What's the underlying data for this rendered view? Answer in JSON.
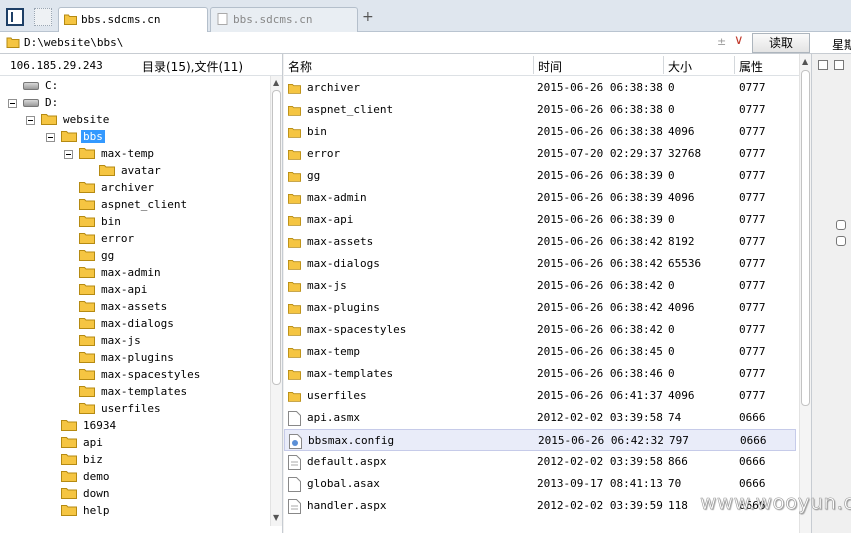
{
  "tabs": [
    {
      "label": "bbs.sdcms.cn",
      "active": true
    },
    {
      "label": "bbs.sdcms.cn",
      "active": false
    }
  ],
  "address": {
    "path": "D:\\website\\bbs\\",
    "read_button": "读取",
    "week_label": "星期"
  },
  "left": {
    "ip": "106.185.29.243",
    "counts": "目录(15),文件(11)"
  },
  "tree": [
    {
      "label": "C:",
      "type": "drive",
      "level": 1,
      "expanded": false,
      "selected": false
    },
    {
      "label": "D:",
      "type": "drive",
      "level": 1,
      "expanded": true,
      "selected": false
    },
    {
      "label": "website",
      "type": "folder",
      "level": 2,
      "expanded": true,
      "selected": false
    },
    {
      "label": "bbs",
      "type": "folder",
      "level": 3,
      "expanded": true,
      "selected": true
    },
    {
      "label": "max-temp",
      "type": "folder",
      "level": 4,
      "expanded": true,
      "selected": false
    },
    {
      "label": "avatar",
      "type": "folder",
      "level": 5,
      "expanded": false,
      "selected": false
    },
    {
      "label": "archiver",
      "type": "folder",
      "level": 4,
      "expanded": false,
      "selected": false
    },
    {
      "label": "aspnet_client",
      "type": "folder",
      "level": 4,
      "expanded": false,
      "selected": false
    },
    {
      "label": "bin",
      "type": "folder",
      "level": 4,
      "expanded": false,
      "selected": false
    },
    {
      "label": "error",
      "type": "folder",
      "level": 4,
      "expanded": false,
      "selected": false
    },
    {
      "label": "gg",
      "type": "folder",
      "level": 4,
      "expanded": false,
      "selected": false
    },
    {
      "label": "max-admin",
      "type": "folder",
      "level": 4,
      "expanded": false,
      "selected": false
    },
    {
      "label": "max-api",
      "type": "folder",
      "level": 4,
      "expanded": false,
      "selected": false
    },
    {
      "label": "max-assets",
      "type": "folder",
      "level": 4,
      "expanded": false,
      "selected": false
    },
    {
      "label": "max-dialogs",
      "type": "folder",
      "level": 4,
      "expanded": false,
      "selected": false
    },
    {
      "label": "max-js",
      "type": "folder",
      "level": 4,
      "expanded": false,
      "selected": false
    },
    {
      "label": "max-plugins",
      "type": "folder",
      "level": 4,
      "expanded": false,
      "selected": false
    },
    {
      "label": "max-spacestyles",
      "type": "folder",
      "level": 4,
      "expanded": false,
      "selected": false
    },
    {
      "label": "max-templates",
      "type": "folder",
      "level": 4,
      "expanded": false,
      "selected": false
    },
    {
      "label": "userfiles",
      "type": "folder",
      "level": 4,
      "expanded": false,
      "selected": false
    },
    {
      "label": "16934",
      "type": "folder",
      "level": 3,
      "expanded": false,
      "selected": false
    },
    {
      "label": "api",
      "type": "folder",
      "level": 3,
      "expanded": false,
      "selected": false
    },
    {
      "label": "biz",
      "type": "folder",
      "level": 3,
      "expanded": false,
      "selected": false
    },
    {
      "label": "demo",
      "type": "folder",
      "level": 3,
      "expanded": false,
      "selected": false
    },
    {
      "label": "down",
      "type": "folder",
      "level": 3,
      "expanded": false,
      "selected": false
    },
    {
      "label": "help",
      "type": "folder",
      "level": 3,
      "expanded": false,
      "selected": false
    }
  ],
  "columns": {
    "name": "名称",
    "time": "时间",
    "size": "大小",
    "attr": "属性"
  },
  "files": [
    {
      "name": "archiver",
      "time": "2015-06-26 06:38:38",
      "size": "0",
      "attr": "0777",
      "kind": "folder"
    },
    {
      "name": "aspnet_client",
      "time": "2015-06-26 06:38:38",
      "size": "0",
      "attr": "0777",
      "kind": "folder"
    },
    {
      "name": "bin",
      "time": "2015-06-26 06:38:38",
      "size": "4096",
      "attr": "0777",
      "kind": "folder"
    },
    {
      "name": "error",
      "time": "2015-07-20 02:29:37",
      "size": "32768",
      "attr": "0777",
      "kind": "folder"
    },
    {
      "name": "gg",
      "time": "2015-06-26 06:38:39",
      "size": "0",
      "attr": "0777",
      "kind": "folder"
    },
    {
      "name": "max-admin",
      "time": "2015-06-26 06:38:39",
      "size": "4096",
      "attr": "0777",
      "kind": "folder"
    },
    {
      "name": "max-api",
      "time": "2015-06-26 06:38:39",
      "size": "0",
      "attr": "0777",
      "kind": "folder"
    },
    {
      "name": "max-assets",
      "time": "2015-06-26 06:38:42",
      "size": "8192",
      "attr": "0777",
      "kind": "folder"
    },
    {
      "name": "max-dialogs",
      "time": "2015-06-26 06:38:42",
      "size": "65536",
      "attr": "0777",
      "kind": "folder"
    },
    {
      "name": "max-js",
      "time": "2015-06-26 06:38:42",
      "size": "0",
      "attr": "0777",
      "kind": "folder"
    },
    {
      "name": "max-plugins",
      "time": "2015-06-26 06:38:42",
      "size": "4096",
      "attr": "0777",
      "kind": "folder"
    },
    {
      "name": "max-spacestyles",
      "time": "2015-06-26 06:38:42",
      "size": "0",
      "attr": "0777",
      "kind": "folder"
    },
    {
      "name": "max-temp",
      "time": "2015-06-26 06:38:45",
      "size": "0",
      "attr": "0777",
      "kind": "folder"
    },
    {
      "name": "max-templates",
      "time": "2015-06-26 06:38:46",
      "size": "0",
      "attr": "0777",
      "kind": "folder"
    },
    {
      "name": "userfiles",
      "time": "2015-06-26 06:41:37",
      "size": "4096",
      "attr": "0777",
      "kind": "folder"
    },
    {
      "name": "api.asmx",
      "time": "2012-02-02 03:39:58",
      "size": "74",
      "attr": "0666",
      "kind": "file"
    },
    {
      "name": "bbsmax.config",
      "time": "2015-06-26 06:42:32",
      "size": "797",
      "attr": "0666",
      "kind": "config",
      "highlighted": true
    },
    {
      "name": "default.aspx",
      "time": "2012-02-02 03:39:58",
      "size": "866",
      "attr": "0666",
      "kind": "doc"
    },
    {
      "name": "global.asax",
      "time": "2013-09-17 08:41:13",
      "size": "70",
      "attr": "0666",
      "kind": "file"
    },
    {
      "name": "handler.aspx",
      "time": "2012-02-02 03:39:59",
      "size": "118",
      "attr": "0666",
      "kind": "doc"
    }
  ],
  "watermark": "www.wooyun.org",
  "colors": {
    "folder": "#f5c542",
    "selection": "#3399ff",
    "row_highlight": "#e9ecf9"
  }
}
